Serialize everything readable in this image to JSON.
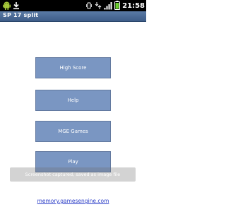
{
  "status_bar": {
    "time": "21:58",
    "icons": [
      "android-icon",
      "download-icon",
      "vibrate-icon",
      "3g-icon",
      "signal-icon",
      "battery-icon"
    ]
  },
  "app_title": "SP 17 split",
  "menu": {
    "high_score": "High Score",
    "help": "Help",
    "mge_games": "MGE Games",
    "play": "Play"
  },
  "toast": "Screenshot captured, saved as image file",
  "footer_link": "memory.gamesengine.com",
  "colors": {
    "title_bar": "#4a6a96",
    "button": "#7a96c2",
    "link": "#2a3cc7"
  }
}
